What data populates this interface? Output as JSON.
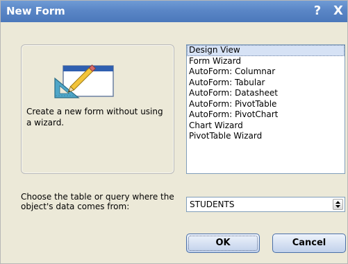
{
  "window": {
    "title": "New Form",
    "help_label": "?",
    "close_label": "X"
  },
  "preview": {
    "icon": "form-design-icon",
    "description": "Create a new form without using a wizard."
  },
  "form_types": {
    "selected": "Design View",
    "items": [
      "Design View",
      "Form Wizard",
      "AutoForm:  Columnar",
      "AutoForm:  Tabular",
      "AutoForm:  Datasheet",
      "AutoForm:  PivotTable",
      "AutoForm:  PivotChart",
      "Chart Wizard",
      "PivotTable Wizard"
    ]
  },
  "source": {
    "label": "Choose the table or query where the object's data comes from:",
    "value": "STUDENTS"
  },
  "buttons": {
    "ok_label": "OK",
    "cancel_label": "Cancel"
  },
  "colors": {
    "titlebar": "#5a86c6",
    "dialog_bg": "#ece9d8",
    "selection": "#d6e2f5"
  }
}
